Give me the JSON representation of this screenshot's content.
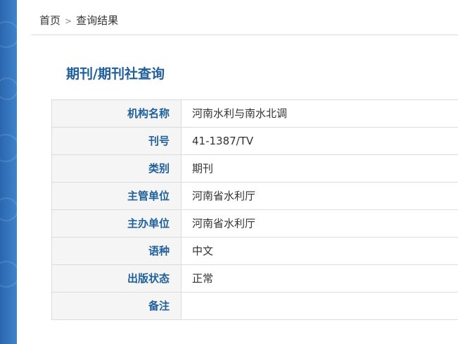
{
  "breadcrumb": {
    "home": "首页",
    "separator": ">",
    "current": "查询结果"
  },
  "page_title": "期刊/期刊社查询",
  "rows": [
    {
      "label": "机构名称",
      "value": "河南水利与南水北调"
    },
    {
      "label": "刊号",
      "value": "41-1387/TV"
    },
    {
      "label": "类别",
      "value": "期刊"
    },
    {
      "label": "主管单位",
      "value": "河南省水利厅"
    },
    {
      "label": "主办单位",
      "value": "河南省水利厅"
    },
    {
      "label": "语种",
      "value": "中文"
    },
    {
      "label": "出版状态",
      "value": "正常"
    },
    {
      "label": "备注",
      "value": ""
    }
  ],
  "colors": {
    "accent": "#1f5f9c",
    "side_strip": "#2c6db4",
    "label_bg": "#f5f5f5",
    "border": "#dcdcdc"
  }
}
